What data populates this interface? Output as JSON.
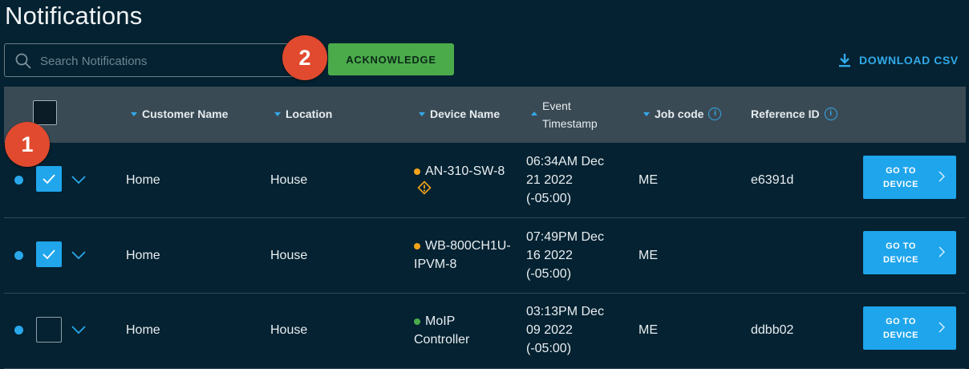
{
  "page": {
    "title": "Notifications"
  },
  "search": {
    "placeholder": "Search Notifications"
  },
  "toolbar": {
    "acknowledge_label": "ACKNOWLEDGE",
    "download_label": "DOWNLOAD CSV"
  },
  "annotations": [
    "1",
    "2"
  ],
  "columns": {
    "customer": "Customer Name",
    "location": "Location",
    "device": "Device Name",
    "event_line1": "Event",
    "event_line2": "Timestamp",
    "jobcode": "Job code",
    "reference": "Reference ID"
  },
  "colors": {
    "background": "#042231",
    "accent": "#1ea5ec",
    "acknowledge": "#4bab4b",
    "badge": "#e14a2e",
    "status_warning": "#f5a31a",
    "status_ok": "#4bab4b"
  },
  "rows": [
    {
      "unread": true,
      "selected": true,
      "customer": "Home",
      "location": "House",
      "device_line1": "AN-310-SW-8",
      "device_line2": "",
      "device_status": "warning",
      "warning_icon": "warning-diamond-icon",
      "ts1": "06:34AM Dec",
      "ts2": "21 2022",
      "ts3": "(-05:00)",
      "jobcode": "ME",
      "reference": "e6391d",
      "goto1": "GO TO",
      "goto2": "DEVICE"
    },
    {
      "unread": true,
      "selected": true,
      "customer": "Home",
      "location": "House",
      "device_line1": "WB-800CH1U-",
      "device_line2": "IPVM-8",
      "device_status": "warning",
      "ts1": "07:49PM Dec",
      "ts2": "16 2022",
      "ts3": "(-05:00)",
      "jobcode": "ME",
      "reference": "",
      "goto1": "GO TO",
      "goto2": "DEVICE"
    },
    {
      "unread": true,
      "selected": false,
      "customer": "Home",
      "location": "House",
      "device_line1": "MoIP",
      "device_line2": "Controller",
      "device_status": "ok",
      "ts1": "03:13PM Dec",
      "ts2": "09 2022",
      "ts3": "(-05:00)",
      "jobcode": "ME",
      "reference": "ddbb02",
      "goto1": "GO TO",
      "goto2": "DEVICE"
    }
  ]
}
